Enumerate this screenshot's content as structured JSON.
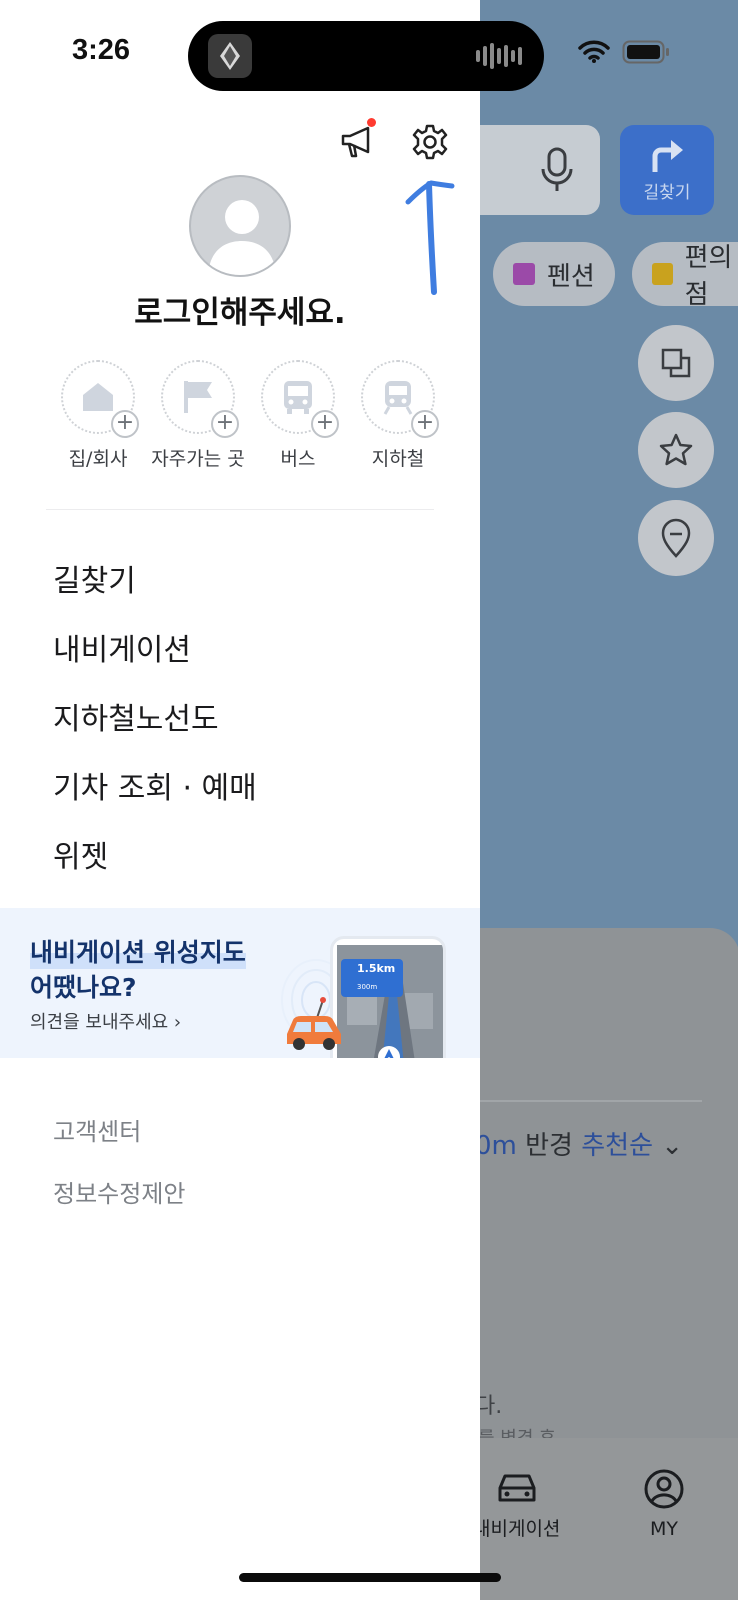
{
  "status_bar": {
    "time": "3:26"
  },
  "drawer": {
    "login_prompt": "로그인해주세요.",
    "shortcuts": [
      {
        "label": "집/회사",
        "icon": "home-icon"
      },
      {
        "label": "자주가는 곳",
        "icon": "flag-icon"
      },
      {
        "label": "버스",
        "icon": "bus-icon"
      },
      {
        "label": "지하철",
        "icon": "subway-icon"
      }
    ],
    "menu": [
      "길찾기",
      "내비게이션",
      "지하철노선도",
      "기차 조회 · 예매",
      "위젯"
    ],
    "banner": {
      "title_line1": "내비게이션 위성지도",
      "title_line2": "어땠나요?",
      "subtitle": "의견을 보내주세요 ›",
      "mock_distance": "1.5km",
      "mock_sub_distance": "300m"
    },
    "footer": [
      "고객센터",
      "정보수정제안"
    ]
  },
  "background": {
    "route_button_label": "길찾기",
    "chips": [
      "펜션",
      "편의점"
    ],
    "radius_prefix": "0m",
    "radius_word": "반경",
    "sort_label": "추천순",
    "frag_line1": "다.",
    "frag_line2": "를 변경 후",
    "tabs": [
      "내비게이션",
      "MY"
    ]
  },
  "colors": {
    "accent_blue": "#3c6fc9",
    "notification_dot": "#ff3b30",
    "banner_bg": "#eef4fd",
    "annotation_blue": "#3f7de0"
  }
}
